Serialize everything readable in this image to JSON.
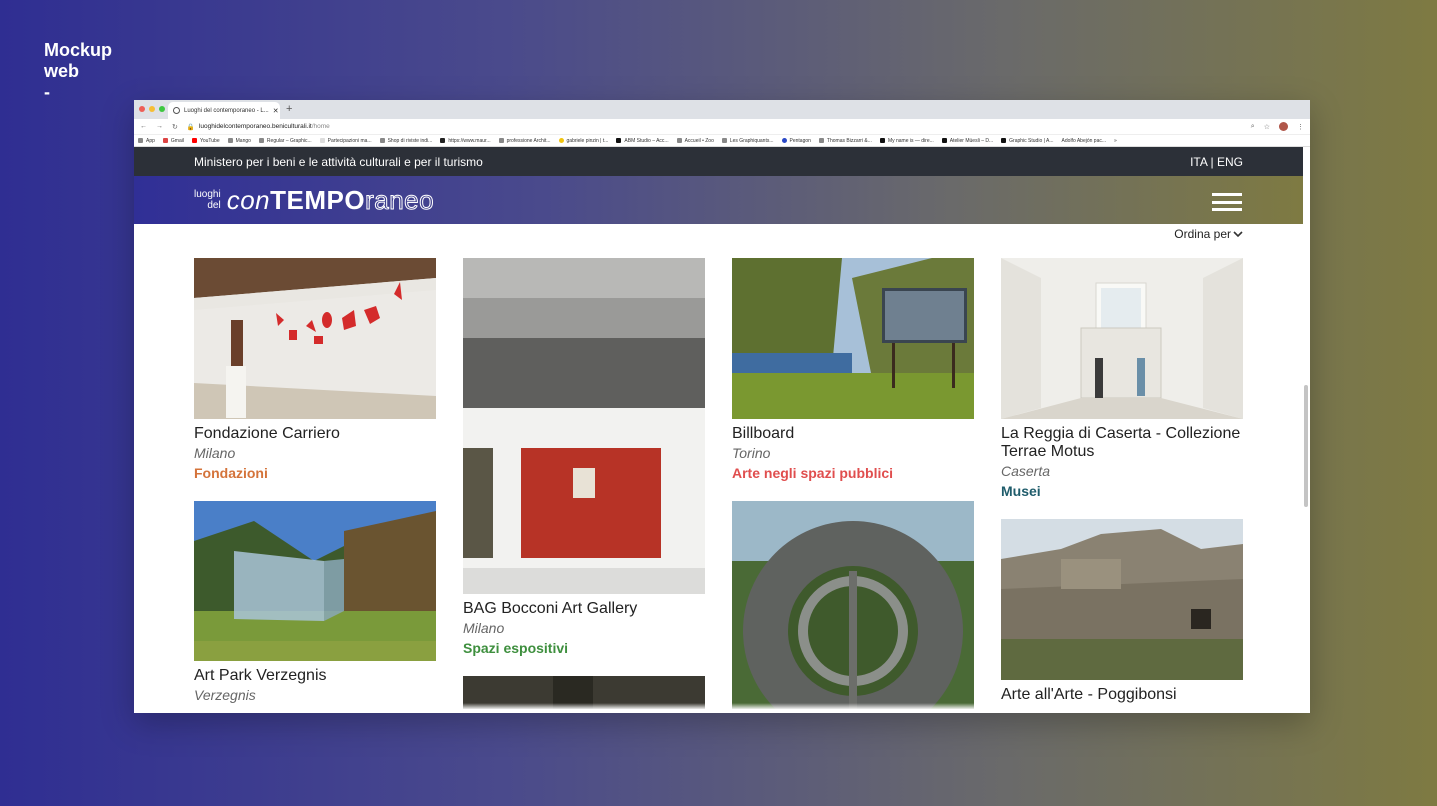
{
  "mockup_label": [
    "Mockup",
    "web",
    "-"
  ],
  "browser": {
    "tab_title": "Luoghi del contemporaneo - L...",
    "url_main": "luoghidelcontemporaneo.beniculturali.it",
    "url_path": "/home",
    "bookmarks": [
      "App",
      "Gmail",
      "YouTube",
      "Mango",
      "Regular – Graphic...",
      "Partecipazioni ma...",
      "Shop di riviste indi...",
      "https://www.maur...",
      "professione Archit...",
      "gabriele pinzin | t...",
      "ABM Studio – Acc...",
      "Accueil • Zoo",
      "Les Graphiquants...",
      "Pentagon",
      "Thomas Bizzarri &...",
      "My name is — dire...",
      "Atelier Müesli – D...",
      "Graphic Studio | A...",
      "Adolfo Abejón pac..."
    ],
    "bookmarks_more": "»"
  },
  "site": {
    "ministry": "Ministero per i beni e le attività culturali e per il turismo",
    "lang": "ITA | ENG",
    "logo_small_1": "luoghi",
    "logo_small_2": "del",
    "logo_con": "con",
    "logo_tempo": "TEMPO",
    "logo_raneo": "raneo",
    "sort_label": "Ordina per"
  },
  "cards": [
    {
      "title": "Fondazione Carriero",
      "city": "Milano",
      "category": "Fondazioni",
      "cat_color": "#d4733a"
    },
    {
      "title": "Art Park Verzegnis",
      "city": "Verzegnis"
    },
    {
      "title": "BAG Bocconi Art Gallery",
      "city": "Milano",
      "category": "Spazi espositivi",
      "cat_color": "#3e8f3e"
    },
    {
      "title": "Billboard",
      "city": "Torino",
      "category": "Arte negli spazi pubblici",
      "cat_color": "#e04e4e"
    },
    {
      "title": "La Reggia di Caserta - Collezione Terrae Motus",
      "city": "Caserta",
      "category": "Musei",
      "cat_color": "#1f5c6b"
    },
    {
      "title": "Arte all'Arte - Poggibonsi"
    }
  ]
}
